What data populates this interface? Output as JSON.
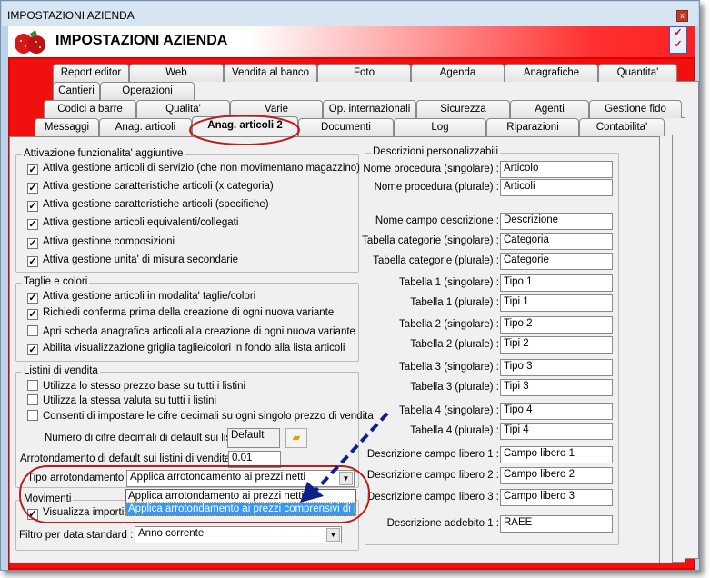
{
  "window": {
    "title": "IMPOSTAZIONI AZIENDA",
    "header_title": "IMPOSTAZIONI AZIENDA",
    "accent": "#f01010"
  },
  "tabs": {
    "row1": [
      "Report editor",
      "Web",
      "Vendita al banco",
      "Foto",
      "Agenda",
      "Anagrafiche",
      "Quantita'"
    ],
    "row2": [
      "Cantieri",
      "Operazioni"
    ],
    "row3": [
      "Codici a barre",
      "Qualita'",
      "Varie",
      "Op. internazionali",
      "Sicurezza",
      "Agenti",
      "Gestione fido"
    ],
    "row4": [
      "Messaggi",
      "Anag. articoli",
      "Anag. articoli 2",
      "Documenti",
      "Log",
      "Riparazioni",
      "Contabilita'"
    ],
    "active": "Anag. articoli 2"
  },
  "attivazione": {
    "title": "Attivazione funzionalita' aggiuntive",
    "items": [
      {
        "label": "Attiva gestione articoli di servizio (che non movimentano magazzino)",
        "checked": true
      },
      {
        "label": "Attiva gestione caratteristiche articoli (x categoria)",
        "checked": true
      },
      {
        "label": "Attiva gestione caratteristiche articoli (specifiche)",
        "checked": true
      },
      {
        "label": "Attiva gestione articoli equivalenti/collegati",
        "checked": true
      },
      {
        "label": "Attiva gestione composizioni",
        "checked": true
      },
      {
        "label": "Attiva gestione unita' di misura secondarie",
        "checked": true
      }
    ]
  },
  "taglie": {
    "title": "Taglie e colori",
    "items": [
      {
        "label": "Attiva gestione articoli in modalita' taglie/colori",
        "checked": true
      },
      {
        "label": "Richiedi conferma prima della creazione di ogni nuova variante",
        "checked": true
      },
      {
        "label": "Apri scheda anagrafica articoli alla creazione di ogni nuova variante",
        "checked": false
      },
      {
        "label": "Abilita visualizzazione griglia taglie/colori in fondo alla lista articoli",
        "checked": true
      }
    ]
  },
  "listini": {
    "title": "Listini di vendita",
    "items": [
      {
        "label": "Utilizza lo stesso prezzo base su tutti i listini",
        "checked": false
      },
      {
        "label": "Utilizza la stessa valuta su tutti i listini",
        "checked": false
      },
      {
        "label": "Consenti di impostare le cifre decimali su ogni singolo prezzo di vendita",
        "checked": false
      }
    ],
    "decimali_label": "Numero di cifre decimali di default sui listini :",
    "decimali_value": "Default",
    "arrot_label": "Arrotondamento di default sui listini di vendita :",
    "arrot_value": "0.01",
    "tipo_label": "Tipo arrotondamento :",
    "tipo_value": "Applica arrotondamento ai prezzi netti",
    "tipo_options": [
      "Applica arrotondamento ai prezzi netti",
      "Applica arrotondamento ai prezzi comprensivi di impo"
    ]
  },
  "movimenti": {
    "title": "Movimenti",
    "item": {
      "label": "Visualizza importi arrotondati su estratto conto",
      "checked": true
    },
    "filtro_label": "Filtro per data standard :",
    "filtro_value": "Anno corrente"
  },
  "descrizioni": {
    "title": "Descrizioni personalizzabili",
    "rows": [
      {
        "label": "Nome procedura (singolare) :",
        "value": "Articolo"
      },
      {
        "label": "Nome procedura (plurale) :",
        "value": "Articoli"
      },
      {
        "label": "Nome campo descrizione :",
        "value": "Descrizione"
      },
      {
        "label": "Tabella categorie (singolare) :",
        "value": "Categoria"
      },
      {
        "label": "Tabella categorie (plurale) :",
        "value": "Categorie"
      },
      {
        "label": "Tabella 1 (singolare) :",
        "value": "Tipo 1"
      },
      {
        "label": "Tabella 1 (plurale) :",
        "value": "Tipi 1"
      },
      {
        "label": "Tabella 2 (singolare) :",
        "value": "Tipo 2"
      },
      {
        "label": "Tabella 2 (plurale) :",
        "value": "Tipi 2"
      },
      {
        "label": "Tabella 3 (singolare) :",
        "value": "Tipo 3"
      },
      {
        "label": "Tabella 3 (plurale) :",
        "value": "Tipi 3"
      },
      {
        "label": "Tabella 4 (singolare) :",
        "value": "Tipo 4"
      },
      {
        "label": "Tabella 4 (plurale) :",
        "value": "Tipi 4"
      },
      {
        "label": "Descrizione campo libero 1 :",
        "value": "Campo libero 1"
      },
      {
        "label": "Descrizione campo libero 2 :",
        "value": "Campo libero 2"
      },
      {
        "label": "Descrizione campo libero 3 :",
        "value": "Campo libero 3"
      },
      {
        "label": "Descrizione addebito 1 :",
        "value": "RAEE"
      }
    ]
  }
}
